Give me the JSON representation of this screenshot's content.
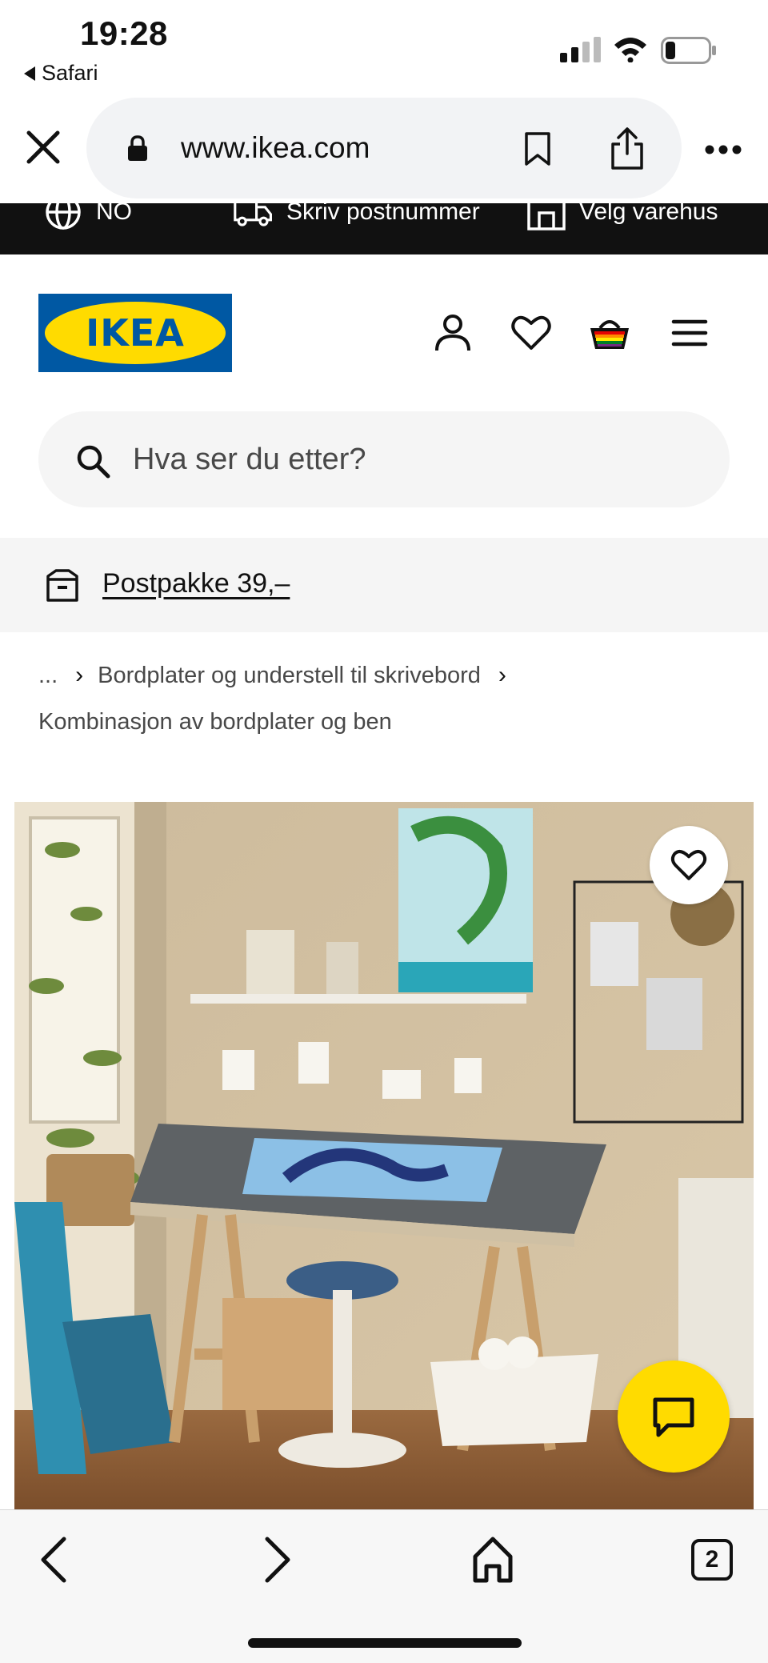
{
  "status_bar": {
    "time": "19:28",
    "back_app": "Safari"
  },
  "browser": {
    "url": "www.ikea.com",
    "icons": [
      "close-icon",
      "lock-icon",
      "bookmark-icon",
      "share-icon",
      "more-icon"
    ]
  },
  "top_strip": {
    "language": "NO",
    "postcode": "Skriv postnummer",
    "store": "Velg varehus"
  },
  "header": {
    "logo_text": "IKEA",
    "icons": [
      "profile-icon",
      "heart-icon",
      "basket-icon",
      "menu-icon"
    ]
  },
  "search": {
    "placeholder": "Hva ser du etter?"
  },
  "banner": {
    "postpakke": "Postpakke 39,–"
  },
  "breadcrumb": {
    "ellipsis": "...",
    "separator": "›",
    "level1": "Bordplater og understell til skrivebord",
    "current": "Kombinasjon av bordplater og ben"
  },
  "toolbar": {
    "tab_count": "2"
  },
  "colors": {
    "ikea_blue": "#0058a3",
    "ikea_yellow": "#ffdb00",
    "strip_black": "#111111",
    "banner_grey": "#f5f5f5"
  }
}
